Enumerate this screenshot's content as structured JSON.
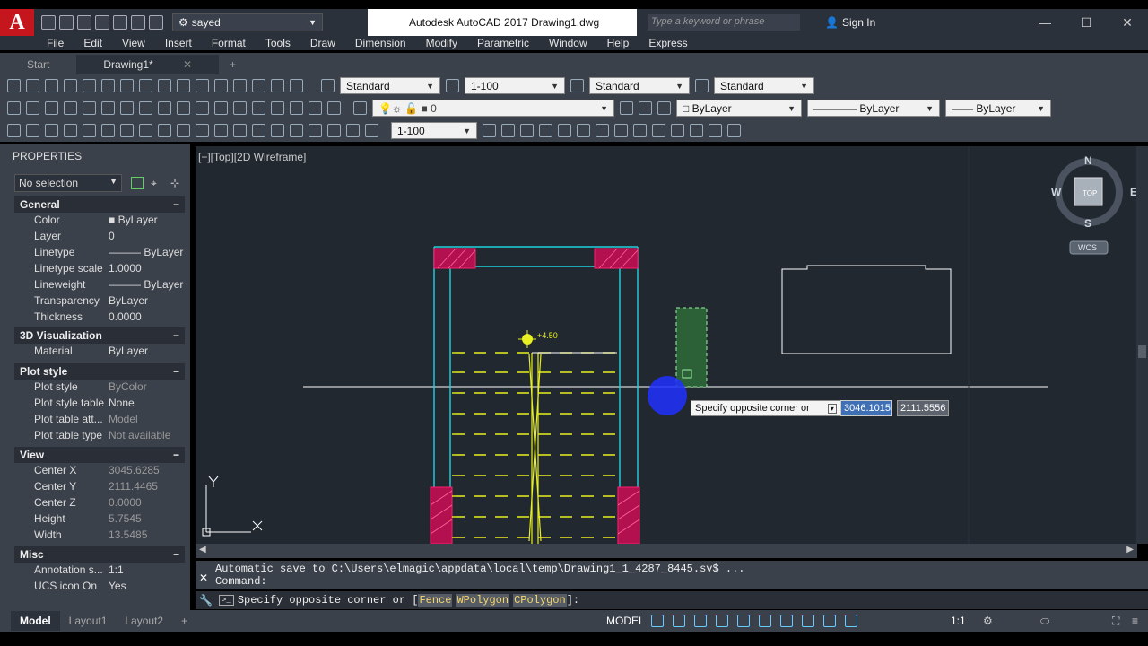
{
  "title_bar": {
    "workspace": "sayed",
    "window_title": "Autodesk AutoCAD 2017    Drawing1.dwg",
    "search_placeholder": "Type a keyword or phrase",
    "sign_in": "Sign In"
  },
  "menu": [
    "File",
    "Edit",
    "View",
    "Insert",
    "Format",
    "Tools",
    "Draw",
    "Dimension",
    "Modify",
    "Parametric",
    "Window",
    "Help",
    "Express"
  ],
  "tabs": [
    {
      "label": "Start"
    },
    {
      "label": "Drawing1*"
    }
  ],
  "toolbars": {
    "text_style": "Standard",
    "dim_scale": "1-100",
    "table_style": "Standard",
    "mleader_style": "Standard",
    "layer": "0",
    "color": "ByLayer",
    "linetype": "ByLayer",
    "lineweight": "ByLayer",
    "dim_style": "1-100"
  },
  "properties": {
    "header": "PROPERTIES",
    "selection": "No selection",
    "sections": {
      "general": "General",
      "visualization": "3D Visualization",
      "plot_style": "Plot style",
      "view": "View",
      "misc": "Misc"
    },
    "general": [
      {
        "k": "Color",
        "v": "ByLayer"
      },
      {
        "k": "Layer",
        "v": "0"
      },
      {
        "k": "Linetype",
        "v": "ByLayer"
      },
      {
        "k": "Linetype scale",
        "v": "1.0000"
      },
      {
        "k": "Lineweight",
        "v": "ByLayer"
      },
      {
        "k": "Transparency",
        "v": "ByLayer"
      },
      {
        "k": "Thickness",
        "v": "0.0000"
      }
    ],
    "visualization": [
      {
        "k": "Material",
        "v": "ByLayer"
      }
    ],
    "plot_style": [
      {
        "k": "Plot style",
        "v": "ByColor"
      },
      {
        "k": "Plot style table",
        "v": "None"
      },
      {
        "k": "Plot table att...",
        "v": "Model"
      },
      {
        "k": "Plot table type",
        "v": "Not available"
      }
    ],
    "view": [
      {
        "k": "Center X",
        "v": "3045.6285"
      },
      {
        "k": "Center Y",
        "v": "2111.4465"
      },
      {
        "k": "Center Z",
        "v": "0.0000"
      },
      {
        "k": "Height",
        "v": "5.7545"
      },
      {
        "k": "Width",
        "v": "13.5485"
      }
    ],
    "misc": [
      {
        "k": "Annotation s...",
        "v": "1:1"
      },
      {
        "k": "UCS icon On",
        "v": "Yes"
      }
    ]
  },
  "viewport": {
    "label": "[−][Top][2D Wireframe]",
    "elevation_tag": "+4.50",
    "tooltip": "Specify opposite corner or",
    "coord_x": "3046.1015",
    "coord_y": "2111.5556",
    "viewcube": {
      "top": "TOP",
      "n": "N",
      "s": "S",
      "e": "E",
      "w": "W",
      "wcs": "WCS"
    }
  },
  "command": {
    "history_1": "Automatic save to C:\\Users\\elmagic\\appdata\\local\\temp\\Drawing1_1_4287_8445.sv$ ...",
    "history_2": "Command:",
    "prompt": "Specify opposite corner or [",
    "opt_fence": "Fence",
    "opt_wpolygon": "WPolygon",
    "opt_cpolygon": "CPolygon",
    "prompt_end": "]:"
  },
  "status": {
    "layouts": [
      "Model",
      "Layout1",
      "Layout2"
    ],
    "space": "MODEL",
    "scale": "1:1"
  }
}
